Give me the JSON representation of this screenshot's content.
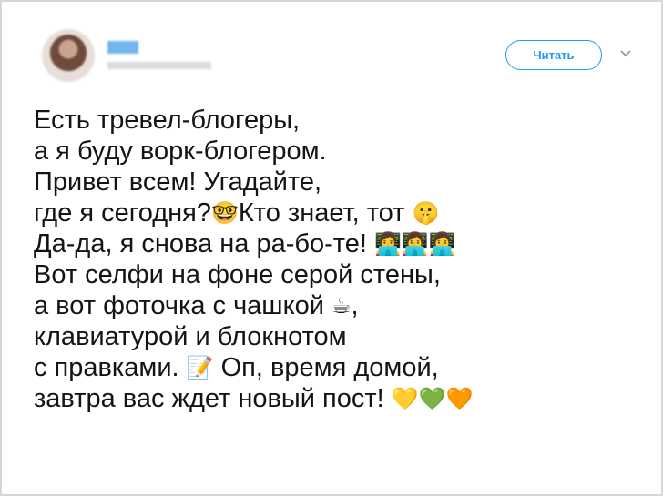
{
  "header": {
    "follow_label": "Читать",
    "avatar_icon": "user-avatar",
    "more_icon": "chevron-down-icon"
  },
  "tweet": {
    "lines": [
      {
        "text": "Есть тревел-блогеры,",
        "emoji": ""
      },
      {
        "text": "а я буду ворк-блогером.",
        "emoji": ""
      },
      {
        "text": "Привет всем! Угадайте,",
        "emoji": ""
      },
      {
        "text": "где я сегодня?",
        "emoji": "🤓",
        "text2": "Кто знает, тот",
        "emoji2": "🤫"
      },
      {
        "text": "Да-да, я снова на ра-бо-те!",
        "emoji": "👩‍💻👩‍💻👩‍💻"
      },
      {
        "text": "Вот селфи на фоне серой стены,",
        "emoji": ""
      },
      {
        "text": "а вот фоточка с чашкой",
        "emoji": "☕",
        "text2": ","
      },
      {
        "text": "клавиатурой и блокнотом",
        "emoji": ""
      },
      {
        "text": "с правками.",
        "emoji": "📝",
        "text2": "Оп, время домой,"
      },
      {
        "text": "завтра вас ждет новый пост!",
        "emoji": "💛💚🧡"
      }
    ]
  },
  "colors": {
    "accent": "#1d9bf0",
    "text": "#141414",
    "border": "#d6d6d6"
  }
}
